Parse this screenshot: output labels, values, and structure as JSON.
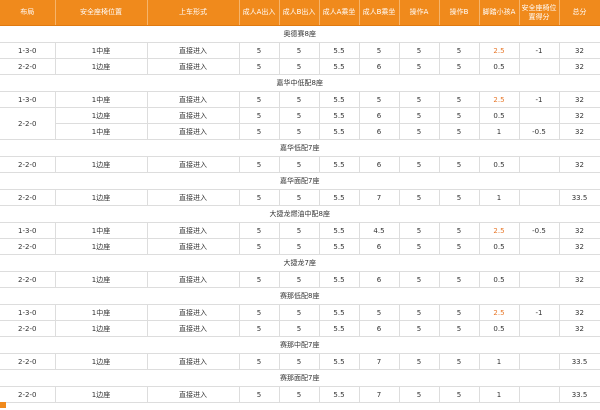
{
  "headers": [
    "布局",
    "安全座椅位置",
    "上车形式",
    "成人A出入",
    "成人B出入",
    "成人A乘坐",
    "成人B乘坐",
    "操作A",
    "操作B",
    "脚踏小孩A",
    "安全座椅位置得分",
    "总分"
  ],
  "sections": [
    {
      "title": "奥德赛8座",
      "rows": [
        {
          "layout": "1-3-0",
          "pos": "1中座",
          "entry": "直接进入",
          "c": [
            "5",
            "5",
            "5.5",
            "5",
            "5",
            "5",
            "2.5",
            "-1",
            "32"
          ]
        },
        {
          "layout": "2-2-0",
          "pos": "1边座",
          "entry": "直接进入",
          "c": [
            "5",
            "5",
            "5.5",
            "6",
            "5",
            "5",
            "0.5",
            "",
            "32"
          ]
        }
      ]
    },
    {
      "title": "嘉华中低配8座",
      "rows": [
        {
          "layout": "1-3-0",
          "pos": "1中座",
          "entry": "直接进入",
          "c": [
            "5",
            "5",
            "5.5",
            "5",
            "5",
            "5",
            "2.5",
            "-1",
            "32"
          ]
        },
        {
          "layout": "2-2-0",
          "pos": "1边座",
          "entry": "直接进入",
          "c": [
            "5",
            "5",
            "5.5",
            "6",
            "5",
            "5",
            "0.5",
            "",
            "32"
          ]
        },
        {
          "layout": "",
          "pos": "1中座",
          "entry": "直接进入",
          "c": [
            "5",
            "5",
            "5.5",
            "6",
            "5",
            "5",
            "1",
            "-0.5",
            "32"
          ]
        }
      ]
    },
    {
      "title": "嘉华低配7座",
      "rows": [
        {
          "layout": "2-2-0",
          "pos": "1边座",
          "entry": "直接进入",
          "c": [
            "5",
            "5",
            "5.5",
            "6",
            "5",
            "5",
            "0.5",
            "",
            "32"
          ]
        }
      ]
    },
    {
      "title": "嘉华面配7座",
      "rows": [
        {
          "layout": "2-2-0",
          "pos": "1边座",
          "entry": "直接进入",
          "c": [
            "5",
            "5",
            "5.5",
            "7",
            "5",
            "5",
            "1",
            "",
            "33.5"
          ]
        }
      ]
    },
    {
      "title": "大捷龙燃油中配8座",
      "rows": [
        {
          "layout": "1-3-0",
          "pos": "1中座",
          "entry": "直接进入",
          "c": [
            "5",
            "5",
            "5.5",
            "4.5",
            "5",
            "5",
            "2.5",
            "-0.5",
            "32"
          ]
        },
        {
          "layout": "2-2-0",
          "pos": "1边座",
          "entry": "直接进入",
          "c": [
            "5",
            "5",
            "5.5",
            "6",
            "5",
            "5",
            "0.5",
            "",
            "32"
          ]
        }
      ]
    },
    {
      "title": "大捷龙7座",
      "rows": [
        {
          "layout": "2-2-0",
          "pos": "1边座",
          "entry": "直接进入",
          "c": [
            "5",
            "5",
            "5.5",
            "6",
            "5",
            "5",
            "0.5",
            "",
            "32"
          ]
        }
      ]
    },
    {
      "title": "赛那低配8座",
      "rows": [
        {
          "layout": "1-3-0",
          "pos": "1中座",
          "entry": "直接进入",
          "c": [
            "5",
            "5",
            "5.5",
            "5",
            "5",
            "5",
            "2.5",
            "-1",
            "32"
          ]
        },
        {
          "layout": "2-2-0",
          "pos": "1边座",
          "entry": "直接进入",
          "c": [
            "5",
            "5",
            "5.5",
            "6",
            "5",
            "5",
            "0.5",
            "",
            "32"
          ]
        }
      ]
    },
    {
      "title": "赛那中配7座",
      "rows": [
        {
          "layout": "2-2-0",
          "pos": "1边座",
          "entry": "直接进入",
          "c": [
            "5",
            "5",
            "5.5",
            "7",
            "5",
            "5",
            "1",
            "",
            "33.5"
          ]
        }
      ]
    },
    {
      "title": "赛那面配7座",
      "rows": [
        {
          "layout": "2-2-0",
          "pos": "1边座",
          "entry": "直接进入",
          "c": [
            "5",
            "5",
            "5.5",
            "7",
            "5",
            "5",
            "1",
            "",
            "33.5"
          ]
        }
      ]
    }
  ],
  "highlight_values": [
    "2.5"
  ],
  "colors": {
    "header_bg": "#f08a1c",
    "highlight": "#e8782a"
  }
}
